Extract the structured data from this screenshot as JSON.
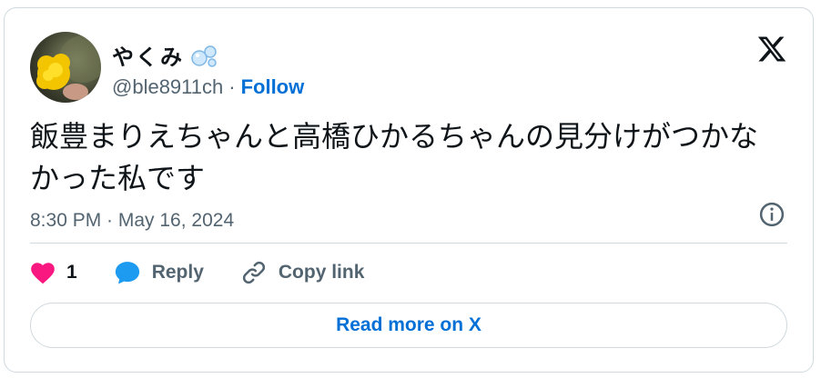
{
  "author": {
    "display_name": "やくみ",
    "handle": "@ble8911ch",
    "separator": "·",
    "follow_label": "Follow"
  },
  "tweet": {
    "text_line1": "飯豊まりえちゃんと高橋ひかるちゃんの見分けがつかな",
    "text_line2": "かった私です",
    "timestamp": "8:30 PM · May 16, 2024"
  },
  "actions": {
    "like_count": "1",
    "reply_label": "Reply",
    "copy_link_label": "Copy link"
  },
  "read_more_label": "Read more on X",
  "colors": {
    "accent": "#006fd6",
    "like": "#f91880",
    "reply": "#1d9bf0",
    "muted": "#536471",
    "border": "#cfd9de"
  },
  "icons": [
    "bubbles-emoji-icon",
    "x-logo-icon",
    "info-icon",
    "heart-icon",
    "reply-bubble-icon",
    "link-icon"
  ]
}
